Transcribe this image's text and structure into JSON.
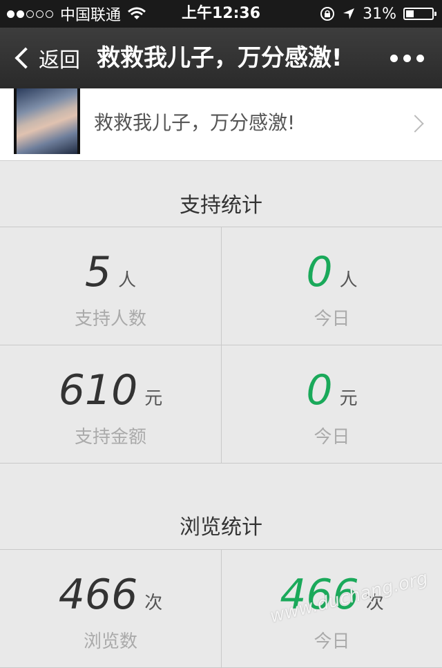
{
  "status_bar": {
    "carrier": "中国联通",
    "time": "上午12:36",
    "battery": "31%",
    "battery_level": 0.31
  },
  "nav": {
    "back_label": "返回",
    "title": "救救我儿子，万分感激!"
  },
  "project": {
    "title": "救救我儿子，万分感激!"
  },
  "support_stats": {
    "title": "支持统计",
    "rows": [
      {
        "left": {
          "value": "5",
          "unit": "人",
          "label": "支持人数"
        },
        "right": {
          "value": "0",
          "unit": "人",
          "label": "今日"
        }
      },
      {
        "left": {
          "value": "610",
          "unit": "元",
          "label": "支持金额"
        },
        "right": {
          "value": "0",
          "unit": "元",
          "label": "今日"
        }
      }
    ]
  },
  "view_stats": {
    "title": "浏览统计",
    "rows": [
      {
        "left": {
          "value": "466",
          "unit": "次",
          "label": "浏览数"
        },
        "right": {
          "value": "466",
          "unit": "次",
          "label": "今日"
        }
      }
    ]
  },
  "watermark": "www.duchang.org",
  "colors": {
    "highlight": "#1aa95a",
    "nav": "#2f2f2f",
    "background": "#e9e9e9"
  }
}
